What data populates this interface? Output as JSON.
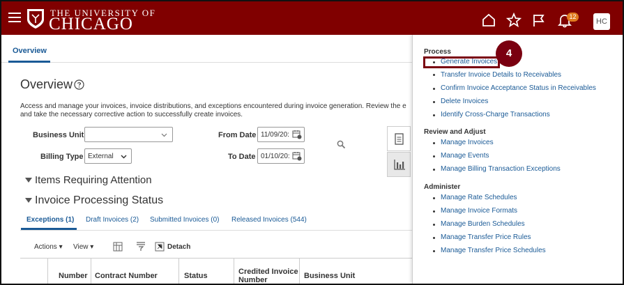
{
  "header": {
    "university_small": "THE UNIVERSITY OF",
    "university_big": "CHICAGO",
    "notification_count": "12",
    "user_initials": "HC"
  },
  "tabs": {
    "overview": "Overview"
  },
  "main": {
    "title": "Overview",
    "description_line1": "Access and manage your invoices, invoice distributions, and exceptions encountered during invoice generation. Review the e",
    "description_line2": "and take the necessary corrective action to successfully create invoices.",
    "business_unit_label": "Business Unit",
    "business_unit_value": "",
    "billing_type_label": "Billing Type",
    "billing_type_value": "External",
    "from_date_label": "From Date",
    "from_date_value": "11/09/20:",
    "to_date_label": "To Date",
    "to_date_value": "01/10/20:",
    "items_requiring_attention": "Items Requiring Attention",
    "invoice_processing_status": "Invoice Processing Status"
  },
  "subtabs": [
    {
      "label": "Exceptions (1)"
    },
    {
      "label": "Draft Invoices (2)"
    },
    {
      "label": "Submitted Invoices (0)"
    },
    {
      "label": "Released Invoices (544)"
    }
  ],
  "toolbar": {
    "actions": "Actions",
    "view": "View",
    "detach": "Detach"
  },
  "table": {
    "columns": [
      "Number",
      "Contract Number",
      "Status",
      "Credited Invoice Number",
      "Business Unit"
    ]
  },
  "panel": {
    "process_heading": "Process",
    "process_links": [
      "Generate Invoices",
      "Transfer Invoice Details to Receivables",
      "Confirm Invoice Acceptance Status in Receivables",
      "Delete Invoices",
      "Identify Cross-Charge Transactions"
    ],
    "review_heading": "Review and Adjust",
    "review_links": [
      "Manage Invoices",
      "Manage Events",
      "Manage Billing Transaction Exceptions"
    ],
    "admin_heading": "Administer",
    "admin_links": [
      "Manage Rate Schedules",
      "Manage Invoice Formats",
      "Manage Burden Schedules",
      "Manage Transfer Price Rules",
      "Manage Transfer Price Schedules"
    ]
  },
  "callout": {
    "step": "4"
  },
  "colors": {
    "brand": "#800000",
    "link": "#1a5a96",
    "callout": "#7a0010",
    "badge": "#e07a1f"
  }
}
